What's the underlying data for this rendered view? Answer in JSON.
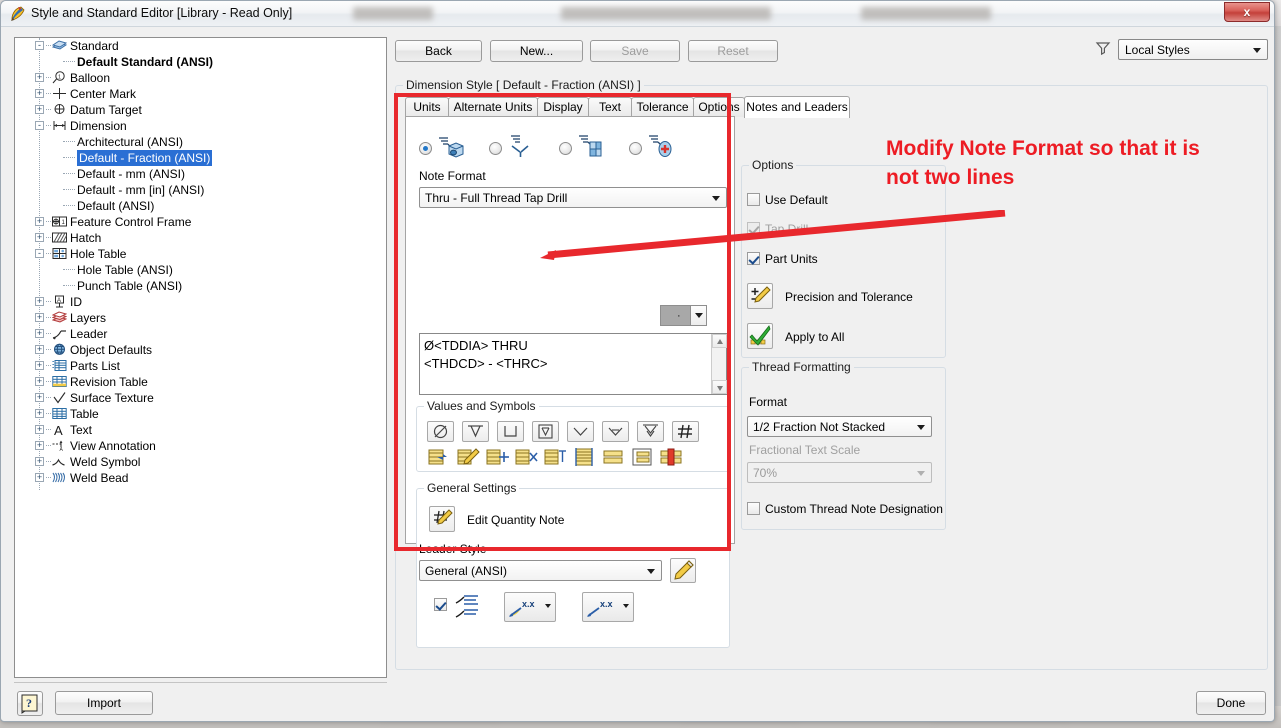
{
  "window": {
    "title": "Style and Standard Editor [Library - Read Only]",
    "close_label": "x",
    "app_icon": "inventor-style-editor-icon"
  },
  "toolbar": {
    "back_label": "Back",
    "new_label": "New...",
    "save_label": "Save",
    "reset_label": "Reset",
    "filter_icon": "funnel-icon",
    "filter_value": "Local Styles"
  },
  "tree": {
    "items": [
      {
        "label": "Standard",
        "indent": 0,
        "toggle": "-",
        "icon": "standard-book-icon",
        "bold": false,
        "selected": false
      },
      {
        "label": "Default Standard (ANSI)",
        "indent": 1,
        "toggle": "",
        "icon": "",
        "bold": true,
        "selected": false
      },
      {
        "label": "Balloon",
        "indent": 0,
        "toggle": "+",
        "icon": "balloon-icon",
        "bold": false,
        "selected": false
      },
      {
        "label": "Center Mark",
        "indent": 0,
        "toggle": "+",
        "icon": "center-mark-icon",
        "bold": false,
        "selected": false
      },
      {
        "label": "Datum Target",
        "indent": 0,
        "toggle": "+",
        "icon": "datum-target-icon",
        "bold": false,
        "selected": false
      },
      {
        "label": "Dimension",
        "indent": 0,
        "toggle": "-",
        "icon": "dimension-icon",
        "bold": false,
        "selected": false
      },
      {
        "label": "Architectural (ANSI)",
        "indent": 1,
        "toggle": "",
        "icon": "",
        "bold": false,
        "selected": false
      },
      {
        "label": "Default - Fraction (ANSI)",
        "indent": 1,
        "toggle": "",
        "icon": "",
        "bold": false,
        "selected": true
      },
      {
        "label": "Default - mm (ANSI)",
        "indent": 1,
        "toggle": "",
        "icon": "",
        "bold": false,
        "selected": false
      },
      {
        "label": "Default - mm [in] (ANSI)",
        "indent": 1,
        "toggle": "",
        "icon": "",
        "bold": false,
        "selected": false
      },
      {
        "label": "Default (ANSI)",
        "indent": 1,
        "toggle": "",
        "icon": "",
        "bold": false,
        "selected": false
      },
      {
        "label": "Feature Control Frame",
        "indent": 0,
        "toggle": "+",
        "icon": "feature-control-frame-icon",
        "bold": false,
        "selected": false
      },
      {
        "label": "Hatch",
        "indent": 0,
        "toggle": "+",
        "icon": "hatch-icon",
        "bold": false,
        "selected": false
      },
      {
        "label": "Hole Table",
        "indent": 0,
        "toggle": "-",
        "icon": "hole-table-icon",
        "bold": false,
        "selected": false
      },
      {
        "label": "Hole Table (ANSI)",
        "indent": 1,
        "toggle": "",
        "icon": "",
        "bold": false,
        "selected": false
      },
      {
        "label": "Punch Table (ANSI)",
        "indent": 1,
        "toggle": "",
        "icon": "",
        "bold": false,
        "selected": false
      },
      {
        "label": "ID",
        "indent": 0,
        "toggle": "+",
        "icon": "id-icon",
        "bold": false,
        "selected": false
      },
      {
        "label": "Layers",
        "indent": 0,
        "toggle": "+",
        "icon": "layers-icon",
        "bold": false,
        "selected": false
      },
      {
        "label": "Leader",
        "indent": 0,
        "toggle": "+",
        "icon": "leader-icon",
        "bold": false,
        "selected": false
      },
      {
        "label": "Object Defaults",
        "indent": 0,
        "toggle": "+",
        "icon": "object-defaults-icon",
        "bold": false,
        "selected": false
      },
      {
        "label": "Parts List",
        "indent": 0,
        "toggle": "+",
        "icon": "parts-list-icon",
        "bold": false,
        "selected": false
      },
      {
        "label": "Revision Table",
        "indent": 0,
        "toggle": "+",
        "icon": "revision-table-icon",
        "bold": false,
        "selected": false
      },
      {
        "label": "Surface Texture",
        "indent": 0,
        "toggle": "+",
        "icon": "surface-texture-icon",
        "bold": false,
        "selected": false
      },
      {
        "label": "Table",
        "indent": 0,
        "toggle": "+",
        "icon": "table-icon",
        "bold": false,
        "selected": false
      },
      {
        "label": "Text",
        "indent": 0,
        "toggle": "+",
        "icon": "text-a-icon",
        "bold": false,
        "selected": false
      },
      {
        "label": "View Annotation",
        "indent": 0,
        "toggle": "+",
        "icon": "view-annotation-icon",
        "bold": false,
        "selected": false
      },
      {
        "label": "Weld Symbol",
        "indent": 0,
        "toggle": "+",
        "icon": "weld-symbol-icon",
        "bold": false,
        "selected": false
      },
      {
        "label": "Weld Bead",
        "indent": 0,
        "toggle": "+",
        "icon": "weld-bead-icon",
        "bold": false,
        "selected": false
      }
    ]
  },
  "main": {
    "group_title": "Dimension Style [ Default - Fraction (ANSI) ]",
    "tabs": [
      {
        "label": "Units",
        "active": false
      },
      {
        "label": "Alternate Units",
        "active": false
      },
      {
        "label": "Display",
        "active": false
      },
      {
        "label": "Text",
        "active": false
      },
      {
        "label": "Tolerance",
        "active": false
      },
      {
        "label": "Options",
        "active": false
      },
      {
        "label": "Notes and Leaders",
        "active": true
      }
    ],
    "note_type_radios": [
      {
        "icon": "hole-note-icon",
        "selected": true
      },
      {
        "icon": "chamfer-note-icon",
        "selected": false
      },
      {
        "icon": "bend-note-icon",
        "selected": false
      },
      {
        "icon": "punch-note-icon",
        "selected": false
      }
    ],
    "note_format_label": "Note Format",
    "note_format_value": "Thru - Full Thread Tap Drill",
    "note_text_lines": [
      "Ø<TDDIA> THRU",
      "<THDCD> - <THRC>"
    ],
    "values_and_symbols": {
      "title": "Values and Symbols",
      "row1": [
        "diameter-symbol-icon",
        "depth-symbol-icon",
        "counterbore-symbol-icon",
        "spotface-symbol-icon",
        "countersink-symbol-icon",
        "conical-taper-symbol-icon",
        "deep-countersink-symbol-icon",
        "quantity-hash-icon"
      ],
      "precision_value": "·"
    },
    "general_settings": {
      "title": "General Settings",
      "edit_quantity_note_label": "Edit Quantity Note",
      "edit_quantity_note_icon": "hash-pencil-icon",
      "leader_style_label": "Leader Style",
      "leader_style_value": "General (ANSI)",
      "edit_leader_icon": "pencil-icon",
      "wrap_checkbox_checked": true,
      "wrap_icon": "leader-text-lines-icon",
      "leader_arrow_button_1": "leader-arrow-xx-filled-icon",
      "leader_arrow_button_2": "leader-arrow-xx-icon"
    },
    "options": {
      "title": "Options",
      "items": [
        {
          "label": "Use Default",
          "checked": false,
          "disabled": false
        },
        {
          "label": "Tap Drill",
          "checked": true,
          "disabled": true
        },
        {
          "label": "Part Units",
          "checked": true,
          "disabled": false
        }
      ],
      "precision_and_tolerance_label": "Precision and Tolerance",
      "precision_and_tolerance_icon": "plus-minus-pencil-icon",
      "apply_to_all_label": "Apply to All",
      "apply_to_all_icon": "green-check-icon"
    },
    "thread_formatting": {
      "title": "Thread Formatting",
      "format_label": "Format",
      "format_value": "1/2 Fraction Not Stacked",
      "fractional_text_scale_label": "Fractional Text Scale",
      "fractional_text_scale_value": "70%",
      "fractional_text_scale_disabled": true,
      "custom_thread_note_label": "Custom Thread Note Designation",
      "custom_thread_note_checked": false
    }
  },
  "footer": {
    "help_icon": "help-question-icon",
    "import_label": "Import",
    "done_label": "Done"
  },
  "annotation": {
    "text_line1": "Modify Note Format so that it is",
    "text_line2": "not two lines",
    "color": "#ed1c24"
  }
}
